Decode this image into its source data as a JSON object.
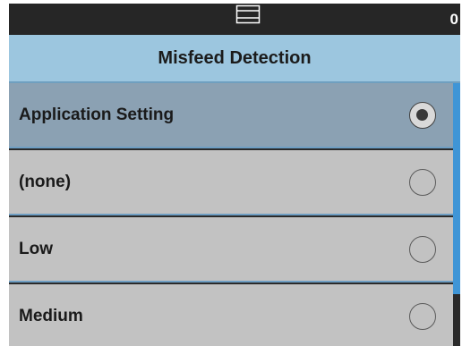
{
  "status_bar": {
    "icon": "scanner-feed-icon",
    "count": "0"
  },
  "header": {
    "title": "Misfeed Detection"
  },
  "options": [
    {
      "label": "Application Setting",
      "selected": true
    },
    {
      "label": "(none)",
      "selected": false
    },
    {
      "label": "Low",
      "selected": false
    },
    {
      "label": "Medium",
      "selected": false
    }
  ],
  "colors": {
    "header_bg": "#9cc6df",
    "selected_row": "#8ba1b3",
    "row_bg": "#c2c2c2",
    "scroll_accent": "#3f95d6"
  }
}
